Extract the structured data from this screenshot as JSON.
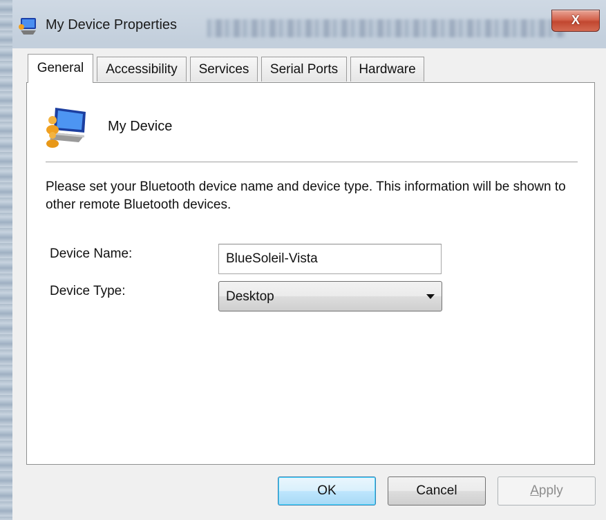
{
  "window": {
    "title": "My Device Properties",
    "close_glyph": "X"
  },
  "tabs": [
    {
      "label": "General",
      "active": true
    },
    {
      "label": "Accessibility",
      "active": false
    },
    {
      "label": "Services",
      "active": false
    },
    {
      "label": "Serial Ports",
      "active": false
    },
    {
      "label": "Hardware",
      "active": false
    }
  ],
  "general": {
    "device_label": "My Device",
    "info_text": "Please set your Bluetooth device name and device type. This information will be shown to other remote Bluetooth devices.",
    "device_name_label": "Device Name:",
    "device_name_value": "BlueSoleil-Vista",
    "device_type_label": "Device Type:",
    "device_type_value": "Desktop"
  },
  "buttons": {
    "ok": "OK",
    "cancel": "Cancel",
    "apply_mnemonic": "A",
    "apply_rest": "pply",
    "apply_enabled": false
  },
  "icons": {
    "app": "bluetooth-device-icon",
    "device": "computer-user-icon",
    "close": "close-icon",
    "dropdown": "chevron-down-icon"
  },
  "colors": {
    "default_button_border": "#3c7fb1",
    "close_button": "#c14730"
  }
}
